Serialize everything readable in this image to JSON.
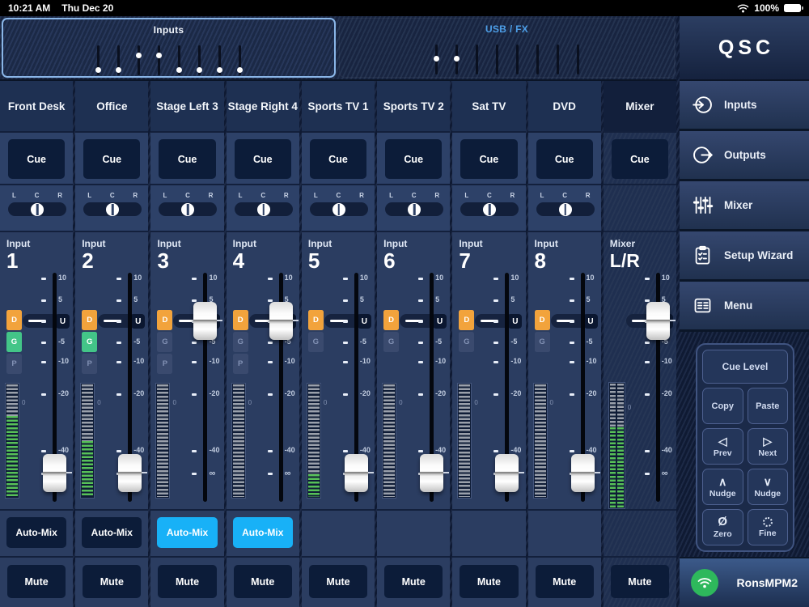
{
  "status_bar": {
    "time": "10:21 AM",
    "date": "Thu Dec 20",
    "battery": "100%"
  },
  "top_panels": {
    "inputs": {
      "title": "Inputs",
      "selected": true,
      "fader_positions": [
        0.9,
        0.9,
        0.3,
        0.3,
        0.9,
        0.9,
        0.9,
        0.9
      ]
    },
    "usb_fx": {
      "title": "USB / FX",
      "selected": false,
      "fader_positions": [
        0.45,
        0.45,
        null,
        null,
        null,
        null,
        null,
        null
      ]
    }
  },
  "pan_labels": {
    "l": "L",
    "c": "C",
    "r": "R"
  },
  "fader_scale": [
    "10",
    "5",
    "U",
    "-5",
    "-10",
    "-20",
    "-40",
    "∞"
  ],
  "meter_zero_label": "0",
  "strips": [
    {
      "name": "Front Desk",
      "type": "input",
      "label_small": "Input",
      "label_big": "1",
      "cue_label": "Cue",
      "pan": "C",
      "dynamics": [
        {
          "label": "D",
          "state": "orange"
        },
        {
          "label": "G",
          "state": "green"
        },
        {
          "label": "P",
          "state": "dim"
        }
      ],
      "meter_green_start": 0.28,
      "fader": "-inf",
      "automix": {
        "label": "Auto-Mix",
        "active": false
      },
      "mute_label": "Mute"
    },
    {
      "name": "Office",
      "type": "input",
      "label_small": "Input",
      "label_big": "2",
      "cue_label": "Cue",
      "pan": "C",
      "dynamics": [
        {
          "label": "D",
          "state": "orange"
        },
        {
          "label": "G",
          "state": "green"
        },
        {
          "label": "P",
          "state": "dim"
        }
      ],
      "meter_green_start": 0.5,
      "fader": "-inf",
      "automix": {
        "label": "Auto-Mix",
        "active": false
      },
      "mute_label": "Mute"
    },
    {
      "name": "Stage Left 3",
      "type": "input",
      "label_small": "Input",
      "label_big": "3",
      "cue_label": "Cue",
      "pan": "C",
      "dynamics": [
        {
          "label": "D",
          "state": "orange"
        },
        {
          "label": "G",
          "state": "dim"
        },
        {
          "label": "P",
          "state": "dim"
        }
      ],
      "meter_green_start": 1,
      "fader": "U",
      "automix": {
        "label": "Auto-Mix",
        "active": true
      },
      "mute_label": "Mute"
    },
    {
      "name": "Stage Right 4",
      "type": "input",
      "label_small": "Input",
      "label_big": "4",
      "cue_label": "Cue",
      "pan": "C",
      "dynamics": [
        {
          "label": "D",
          "state": "orange"
        },
        {
          "label": "G",
          "state": "dim"
        },
        {
          "label": "P",
          "state": "dim"
        }
      ],
      "meter_green_start": 1,
      "fader": "U",
      "automix": {
        "label": "Auto-Mix",
        "active": true
      },
      "mute_label": "Mute"
    },
    {
      "name": "Sports TV 1",
      "type": "input",
      "label_small": "Input",
      "label_big": "5",
      "cue_label": "Cue",
      "pan": "C",
      "dynamics": [
        {
          "label": "D",
          "state": "orange"
        },
        {
          "label": "G",
          "state": "dim"
        }
      ],
      "meter_green_start": 0.8,
      "fader": "-inf",
      "automix": null,
      "mute_label": "Mute"
    },
    {
      "name": "Sports TV 2",
      "type": "input",
      "label_small": "Input",
      "label_big": "6",
      "cue_label": "Cue",
      "pan": "C",
      "dynamics": [
        {
          "label": "D",
          "state": "orange"
        },
        {
          "label": "G",
          "state": "dim"
        }
      ],
      "meter_green_start": 1,
      "fader": "-inf",
      "automix": null,
      "mute_label": "Mute"
    },
    {
      "name": "Sat TV",
      "type": "input",
      "label_small": "Input",
      "label_big": "7",
      "cue_label": "Cue",
      "pan": "C",
      "dynamics": [
        {
          "label": "D",
          "state": "orange"
        },
        {
          "label": "G",
          "state": "dim"
        }
      ],
      "meter_green_start": 1,
      "fader": "-inf",
      "automix": null,
      "mute_label": "Mute"
    },
    {
      "name": "DVD",
      "type": "input",
      "label_small": "Input",
      "label_big": "8",
      "cue_label": "Cue",
      "pan": "C",
      "dynamics": [
        {
          "label": "D",
          "state": "orange"
        },
        {
          "label": "G",
          "state": "dim"
        }
      ],
      "meter_green_start": 1,
      "fader": "-inf",
      "automix": null,
      "mute_label": "Mute"
    },
    {
      "name": "Mixer",
      "type": "master",
      "label_small": "Mixer",
      "label_big": "L/R",
      "cue_label": "Cue",
      "pan": null,
      "dynamics": [],
      "meter_stereo": true,
      "meter_green_start": 0.35,
      "fader": "U",
      "automix": null,
      "mute_label": "Mute"
    }
  ],
  "sidebar": {
    "logo": "QSC",
    "nav": [
      {
        "label": "Inputs",
        "icon": "input-arrow-icon"
      },
      {
        "label": "Outputs",
        "icon": "output-arrow-icon"
      },
      {
        "label": "Mixer",
        "icon": "faders-icon"
      },
      {
        "label": "Setup Wizard",
        "icon": "clipboard-checklist-icon"
      },
      {
        "label": "Menu",
        "icon": "menu-list-icon"
      }
    ],
    "keypad": {
      "cue_level": "Cue Level",
      "copy": "Copy",
      "paste": "Paste",
      "prev": "Prev",
      "next": "Next",
      "nudge_up": "Nudge",
      "nudge_down": "Nudge",
      "zero": "Zero",
      "fine": "Fine"
    },
    "connection": {
      "device": "RonsMPM2"
    }
  },
  "colors": {
    "automix_active": "#18b1f7",
    "dynamics_d": "#f2a33c",
    "dynamics_g": "#43c588",
    "meter_green": "#57c158",
    "meter_gray": "#9aa0ab",
    "selected_outline": "#8ab6e8",
    "usb_fx_title": "#4d9fe8",
    "wifi_connected": "#2eb85c",
    "strip_bg": "#2b3d61",
    "button_bg": "#0c1c39"
  }
}
